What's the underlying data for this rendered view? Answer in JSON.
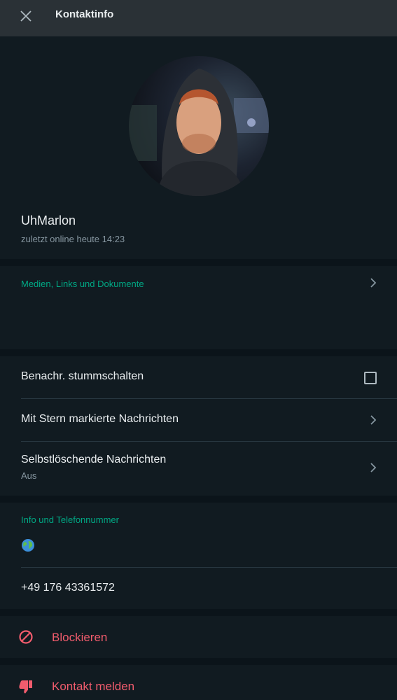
{
  "header": {
    "title": "Kontaktinfo",
    "close_icon": "close-icon"
  },
  "profile": {
    "name": "UhMarlon",
    "status": "zuletzt online heute 14:23"
  },
  "media": {
    "label": "Medien, Links und Dokumente"
  },
  "settings": {
    "mute_label": "Benachr. stummschalten",
    "starred_label": "Mit Stern markierte Nachrichten",
    "disappearing_label": "Selbstlöschende Nachrichten",
    "disappearing_value": "Aus"
  },
  "info": {
    "label": "Info und Telefonnummer",
    "about": "🌍",
    "phone": "+49 176 43361572"
  },
  "actions": {
    "block_label": "Blockieren",
    "report_label": "Kontakt melden"
  },
  "colors": {
    "accent": "#00a884",
    "danger": "#f15c6d",
    "background": "#111b21",
    "header": "#2a3136"
  }
}
